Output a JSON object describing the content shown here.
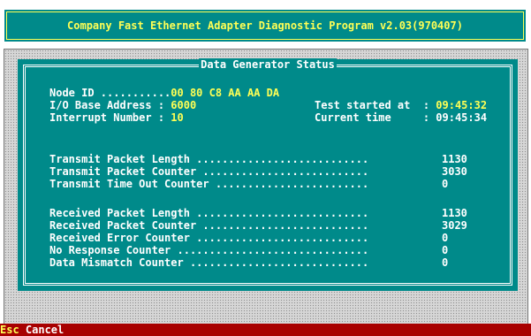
{
  "title": "Company Fast Ethernet Adapter Diagnostic Program v2.03(970407)",
  "panel": {
    "title": "Data Generator Status",
    "node_id": {
      "label": "Node ID ...........",
      "value": "00 80 C8 AA AA DA"
    },
    "io_base": {
      "label": "I/O Base Address : ",
      "value": "6000"
    },
    "interrupt": {
      "label": "Interrupt Number : ",
      "value": "10"
    },
    "test_started": {
      "label": "Test started at  : ",
      "value": "09:45:32"
    },
    "current_time": {
      "label": "Current time     : ",
      "value": "09:45:34"
    },
    "transmit_rows": [
      {
        "label": "Transmit Packet Length ...........................",
        "value": "1130"
      },
      {
        "label": "Transmit Packet Counter ..........................",
        "value": "3030"
      },
      {
        "label": "Transmit Time Out Counter ........................",
        "value": "0"
      }
    ],
    "receive_rows": [
      {
        "label": "Received Packet Length ...........................",
        "value": "1130"
      },
      {
        "label": "Received Packet Counter ..........................",
        "value": "3029"
      },
      {
        "label": "Received Error Counter ...........................",
        "value": "0"
      },
      {
        "label": "No Response Counter ..............................",
        "value": "0"
      },
      {
        "label": "Data Mismatch Counter ............................",
        "value": "0"
      }
    ]
  },
  "statusbar": {
    "key": "Esc",
    "label": " Cancel"
  }
}
